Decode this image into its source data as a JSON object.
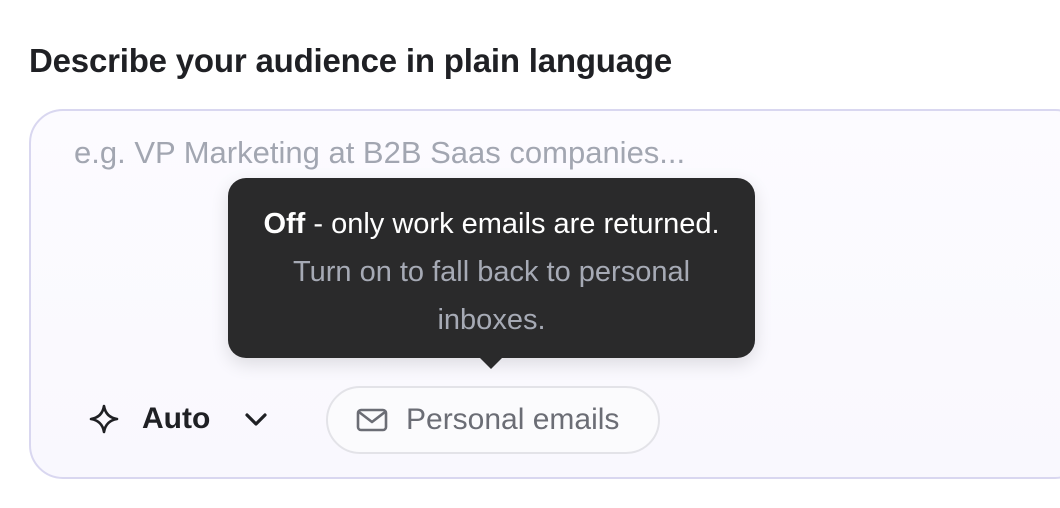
{
  "heading": "Describe your audience in plain language",
  "prompt": {
    "value": "",
    "placeholder": "e.g. VP Marketing at B2B Saas companies..."
  },
  "mode_select": {
    "icon": "sparkle-icon",
    "label": "Auto",
    "chevron_icon": "chevron-down-icon"
  },
  "personal_emails_toggle": {
    "icon": "mail-icon",
    "label": "Personal emails",
    "state": "off"
  },
  "tooltip": {
    "state_word": "Off",
    "line_a": " - only work emails are returned.",
    "line_b": " Turn on to fall back to personal inboxes."
  },
  "colors": {
    "text": "#1f2024",
    "placeholder": "#a2a6b1",
    "box_border": "#d9d7f0",
    "tooltip_bg": "#2a2a2b",
    "tooltip_muted": "#a6aab5",
    "pill_border": "#e3e3e8",
    "pill_text": "#6b6d75"
  }
}
